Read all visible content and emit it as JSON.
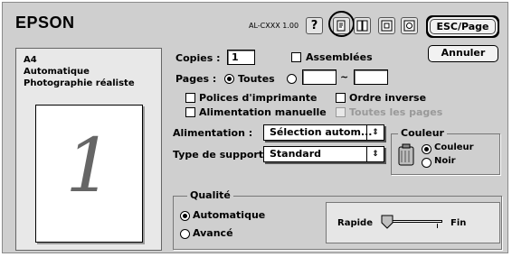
{
  "header": {
    "brand": "EPSON",
    "model": "AL-CXXX 1.00",
    "toolbar_icons": [
      "help-icon",
      "layout-icon",
      "watermark-icon",
      "page-setup-icon",
      "utility-icon"
    ],
    "help_glyph": "?"
  },
  "buttons": {
    "esc_page": "ESC/Page",
    "cancel": "Annuler"
  },
  "summary": {
    "paper": "A4",
    "feed": "Automatique",
    "mode": "Photographie réaliste",
    "preview_number": "1"
  },
  "copies": {
    "label": "Copies :",
    "value": "1",
    "collate_label": "Assemblées",
    "collate_checked": false
  },
  "pages": {
    "label": "Pages :",
    "all_label": "Toutes",
    "selected": "all",
    "from": "",
    "to": "",
    "separator": "~"
  },
  "options": {
    "printer_fonts": "Polices d'imprimante",
    "reverse_order": "Ordre inverse",
    "manual_feed": "Alimentation manuelle",
    "all_pages": "Toutes les pages"
  },
  "feed_select": {
    "label": "Alimentation :",
    "value": "Sélection autom..."
  },
  "media_select": {
    "label": "Type de support :",
    "value": "Standard"
  },
  "color_group": {
    "title": "Couleur",
    "color_label": "Couleur",
    "mono_label": "Noir",
    "selected": "color"
  },
  "quality_group": {
    "title": "Qualité",
    "auto_label": "Automatique",
    "advanced_label": "Avancé",
    "selected": "auto"
  },
  "speed_slider": {
    "fast_label": "Rapide",
    "fine_label": "Fin",
    "level": 0
  }
}
